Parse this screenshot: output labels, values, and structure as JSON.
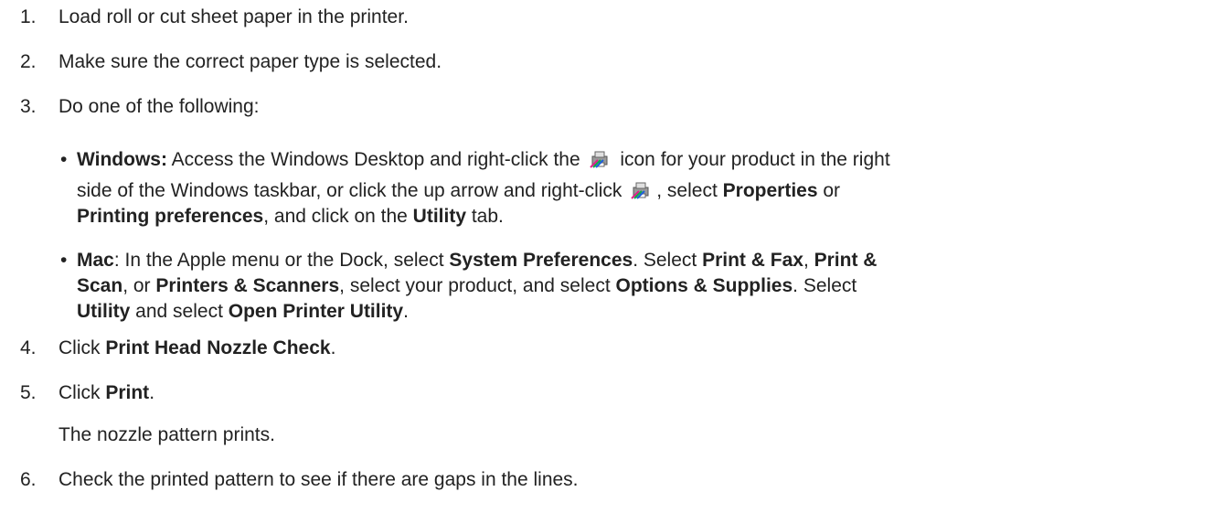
{
  "steps": [
    {
      "num": "1.",
      "text": "Load roll or cut sheet paper in the printer."
    },
    {
      "num": "2.",
      "text": "Make sure the correct paper type is selected."
    },
    {
      "num": "3.",
      "text": "Do one of the following:"
    },
    {
      "num": "4.",
      "pre": "Click ",
      "bold": "Print Head Nozzle Check",
      "post": "."
    },
    {
      "num": "5.",
      "pre": "Click ",
      "bold": "Print",
      "post": ".",
      "result": "The nozzle pattern prints."
    },
    {
      "num": "6.",
      "text": "Check the printed pattern to see if there are gaps in the lines."
    }
  ],
  "bullet_symbol": "•",
  "windows": {
    "label": "Windows:",
    "t1": " Access the Windows Desktop and right-click the ",
    "t2": " icon for your product in the right",
    "t3": "side of the Windows taskbar, or click the up arrow and right-click ",
    "t4": ", select ",
    "b1": "Properties",
    "t5": " or",
    "b2": "Printing preferences",
    "t6": ", and click on the ",
    "b3": "Utility",
    "t7": " tab."
  },
  "mac": {
    "label": "Mac",
    "t1": ": In the Apple menu or the Dock, select ",
    "b1": "System Preferences",
    "t2": ". Select ",
    "b2": "Print & Fax",
    "t3": ", ",
    "b3": "Print &",
    "b4": "Scan",
    "t4": ", or ",
    "b5": "Printers & Scanners",
    "t5": ", select your product, and select ",
    "b6": "Options & Supplies",
    "t6": ". Select",
    "b7": "Utility",
    "t7": " and select ",
    "b8": "Open Printer Utility",
    "t8": "."
  },
  "icons": {
    "printer_tray": "printer-tray-icon"
  }
}
